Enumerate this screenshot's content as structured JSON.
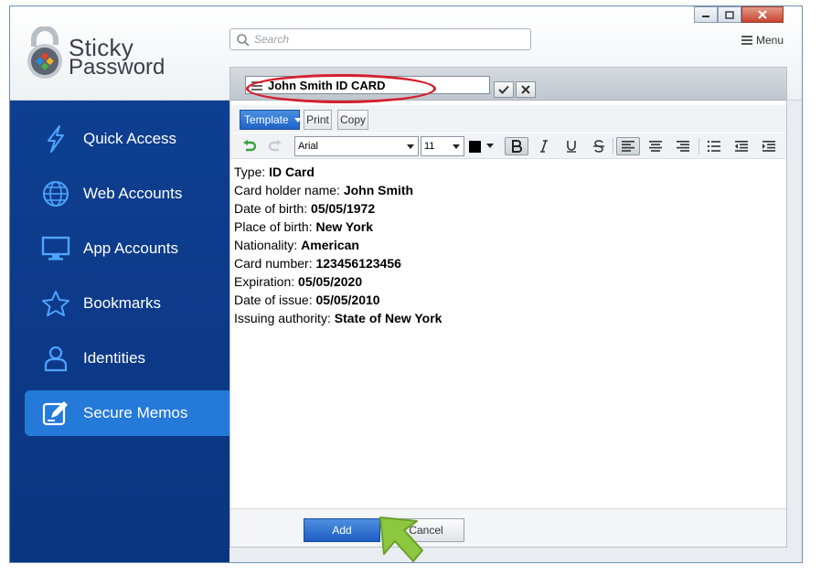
{
  "brand": {
    "line1": "Sticky",
    "line2": "Password"
  },
  "search": {
    "placeholder": "Search"
  },
  "header": {
    "menu_label": "Menu"
  },
  "sidebar": {
    "items": [
      {
        "label": "Quick Access",
        "icon": "lightning-icon"
      },
      {
        "label": "Web Accounts",
        "icon": "globe-icon"
      },
      {
        "label": "App Accounts",
        "icon": "monitor-icon"
      },
      {
        "label": "Bookmarks",
        "icon": "star-icon"
      },
      {
        "label": "Identities",
        "icon": "person-icon"
      },
      {
        "label": "Secure Memos",
        "icon": "memo-edit-icon",
        "active": true
      }
    ]
  },
  "memo": {
    "title": "John Smith ID CARD",
    "toolbar": {
      "template_label": "Template",
      "print_label": "Print",
      "copy_label": "Copy"
    },
    "format": {
      "font": "Arial",
      "size": "11"
    },
    "lines": [
      {
        "label": "Type: ",
        "value": "ID Card"
      },
      {
        "label": "Card holder name: ",
        "value": "John Smith"
      },
      {
        "label": "Date of birth: ",
        "value": "05/05/1972"
      },
      {
        "label": "Place of birth: ",
        "value": "New York"
      },
      {
        "label": "Nationality: ",
        "value": "American"
      },
      {
        "label": "Card number: ",
        "value": "123456123456"
      },
      {
        "label": "Expiration: ",
        "value": "05/05/2020"
      },
      {
        "label": "Date of issue: ",
        "value": "05/05/2010"
      },
      {
        "label": "Issuing authority: ",
        "value": "State of New York"
      }
    ],
    "footer": {
      "add_label": "Add",
      "cancel_label": "Cancel"
    }
  },
  "colors": {
    "sidebar_bg": "#0f3f91",
    "active_item": "#2479d9",
    "highlight_ellipse": "#d51f2e",
    "pointer_arrow": "#8dc63f"
  }
}
